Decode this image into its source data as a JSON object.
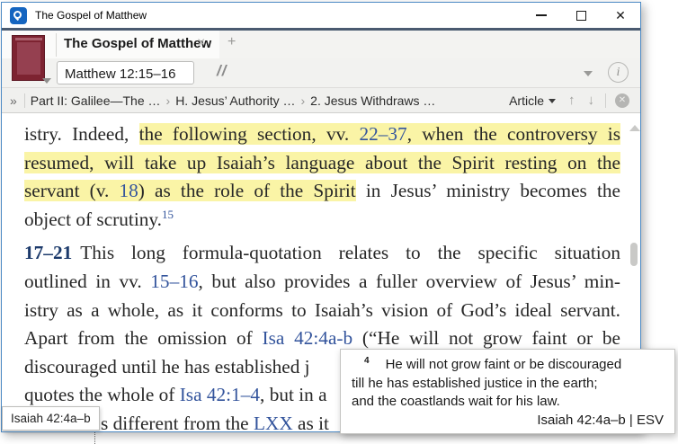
{
  "window": {
    "title": "The Gospel of Matthew"
  },
  "tab": {
    "label": "The Gospel of Matthew"
  },
  "toolbar": {
    "reference_input": {
      "value": "Matthew 12:15–16"
    }
  },
  "breadcrumb": {
    "items": [
      "Part II: Galilee—The …",
      "H. Jesus’ Authority …",
      "2. Jesus Withdraws …"
    ],
    "article_label": "Article"
  },
  "icons": {
    "close_window": "✕",
    "tab_close": "×",
    "new_tab": "+",
    "parallel": "//",
    "breadcrumb_expand": "»",
    "crumb_separator": "›",
    "nav_up": "↑",
    "nav_down": "↓",
    "close_circle": "✕",
    "info": "i"
  },
  "colors": {
    "highlight": "#faf4a6",
    "link_blue": "#33549c",
    "verse_bold": "#1c3a6b",
    "window_border": "#4d8ac4",
    "title_band": "#4a5a70"
  },
  "content": {
    "lines": [
      {
        "segs": [
          {
            "t": "istry. Indeed, "
          },
          {
            "t": "the following section, ",
            "hl": true
          },
          {
            "t": "vv. ",
            "hl": true
          },
          {
            "t": "22–37",
            "hl": true,
            "link": true
          },
          {
            "t": ", when the controversy is",
            "hl": true
          }
        ]
      },
      {
        "segs": [
          {
            "t": "resumed, will take up Isaiah’s language about the Spirit resting on the",
            "hl": true
          }
        ]
      },
      {
        "segs": [
          {
            "t": "servant (v. ",
            "hl": true
          },
          {
            "t": "18",
            "hl": true,
            "link": true
          },
          {
            "t": ") as the role of the Spirit",
            "hl": true
          },
          {
            "t": " in Jesus’ ministry becomes the"
          }
        ]
      },
      {
        "noj": true,
        "segs": [
          {
            "t": "object of scrutiny."
          },
          {
            "t": "15",
            "sup": true,
            "link": true
          }
        ]
      },
      {
        "para": true,
        "segs": [
          {
            "t": "17–21",
            "bold": true
          },
          {
            "t": "This long formula-quotation relates to the specific situation"
          }
        ]
      },
      {
        "segs": [
          {
            "t": "outlined in vv. "
          },
          {
            "t": "15–16",
            "link": true
          },
          {
            "t": ", but also provides a fuller overview of Jesus’ min-"
          }
        ]
      },
      {
        "segs": [
          {
            "t": "istry as a whole, as it conforms to Isaiah’s vision of God’s ideal servant."
          }
        ]
      },
      {
        "segs": [
          {
            "t": "Apart from the omission of "
          },
          {
            "t": "Isa 42:4a-b",
            "link": true
          },
          {
            "t": " (“He will not grow faint or be"
          }
        ]
      },
      {
        "noj": true,
        "segs": [
          {
            "t": "discouraged until he has established j"
          }
        ]
      },
      {
        "noj": true,
        "segs": [
          {
            "t": "quotes the whole of "
          },
          {
            "t": "Isa 42:1–4",
            "link": true
          },
          {
            "t": ", but in a"
          }
        ]
      },
      {
        "noj": true,
        "padLeft": 85,
        "segs": [
          {
            "t": "s different from the "
          },
          {
            "t": "LXX",
            "link": true
          },
          {
            "t": " as it"
          }
        ]
      }
    ]
  },
  "popup": {
    "verse_num": "4",
    "line1": "He will not grow faint or be discouraged",
    "line2": "till he has established justice in the earth;",
    "line3": "and the coastlands wait for his law.",
    "citation": "Isaiah 42:4a–b | ESV"
  },
  "tooltip": {
    "text": "Isaiah 42:4a–b"
  }
}
